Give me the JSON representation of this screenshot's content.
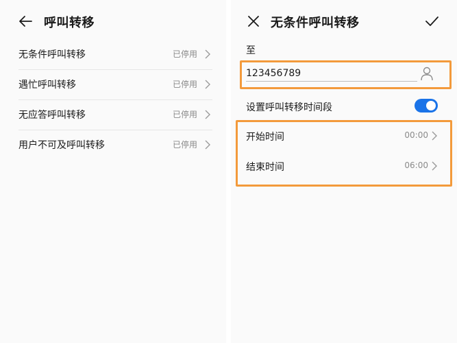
{
  "left_screen": {
    "title": "呼叫转移",
    "items": [
      {
        "label": "无条件呼叫转移",
        "status": "已停用"
      },
      {
        "label": "遇忙呼叫转移",
        "status": "已停用"
      },
      {
        "label": "无应答呼叫转移",
        "status": "已停用"
      },
      {
        "label": "用户不可及呼叫转移",
        "status": "已停用"
      }
    ]
  },
  "right_screen": {
    "title": "无条件呼叫转移",
    "to_label": "至",
    "number_value": "123456789",
    "toggle_label": "设置呼叫转移时间段",
    "toggle_on": true,
    "start_label": "开始时间",
    "start_value": "00:00",
    "end_label": "结束时间",
    "end_value": "06:00"
  },
  "colors": {
    "accent": "#1a73e8",
    "highlight": "#f39a3b",
    "secondary_text": "#8a8a8a"
  }
}
